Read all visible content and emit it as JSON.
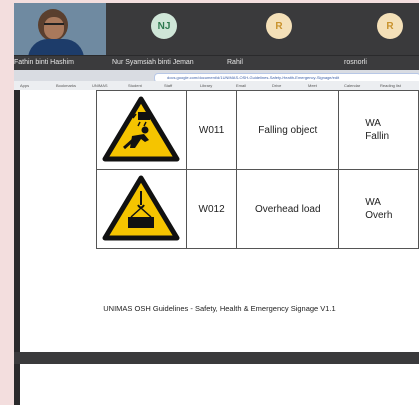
{
  "participants": {
    "self_name": "Fathin binti Hashim",
    "others": [
      {
        "initials": "NJ",
        "name": "Nur Syamsiah binti Jeman"
      },
      {
        "initials": "R",
        "name": "Rahil"
      },
      {
        "initials": "R",
        "name": "rosnorli"
      }
    ]
  },
  "browser": {
    "url": "docs.google.com/document/d/1UNIMAS-OSH-Guidelines-Safety-Health-Emergency-Signage/edit",
    "bookmarks": [
      "Apps",
      "Bookmarks",
      "UNIMAS",
      "Student",
      "Staff",
      "Library",
      "Email",
      "Drive",
      "Meet",
      "Calendar",
      "Reading list"
    ]
  },
  "table": {
    "rows": [
      {
        "code": "W011",
        "description": "Falling object",
        "text_line1": "WA",
        "text_line2": "Fallin"
      },
      {
        "code": "W012",
        "description": "Overhead load",
        "text_line1": "WA",
        "text_line2": "Overh"
      }
    ]
  },
  "footer": "UNIMAS OSH Guidelines - Safety, Health & Emergency Signage V1.1",
  "colors": {
    "warning_yellow": "#f5c400",
    "background": "#f3dede",
    "meeting_dark": "#2a2a2c"
  }
}
